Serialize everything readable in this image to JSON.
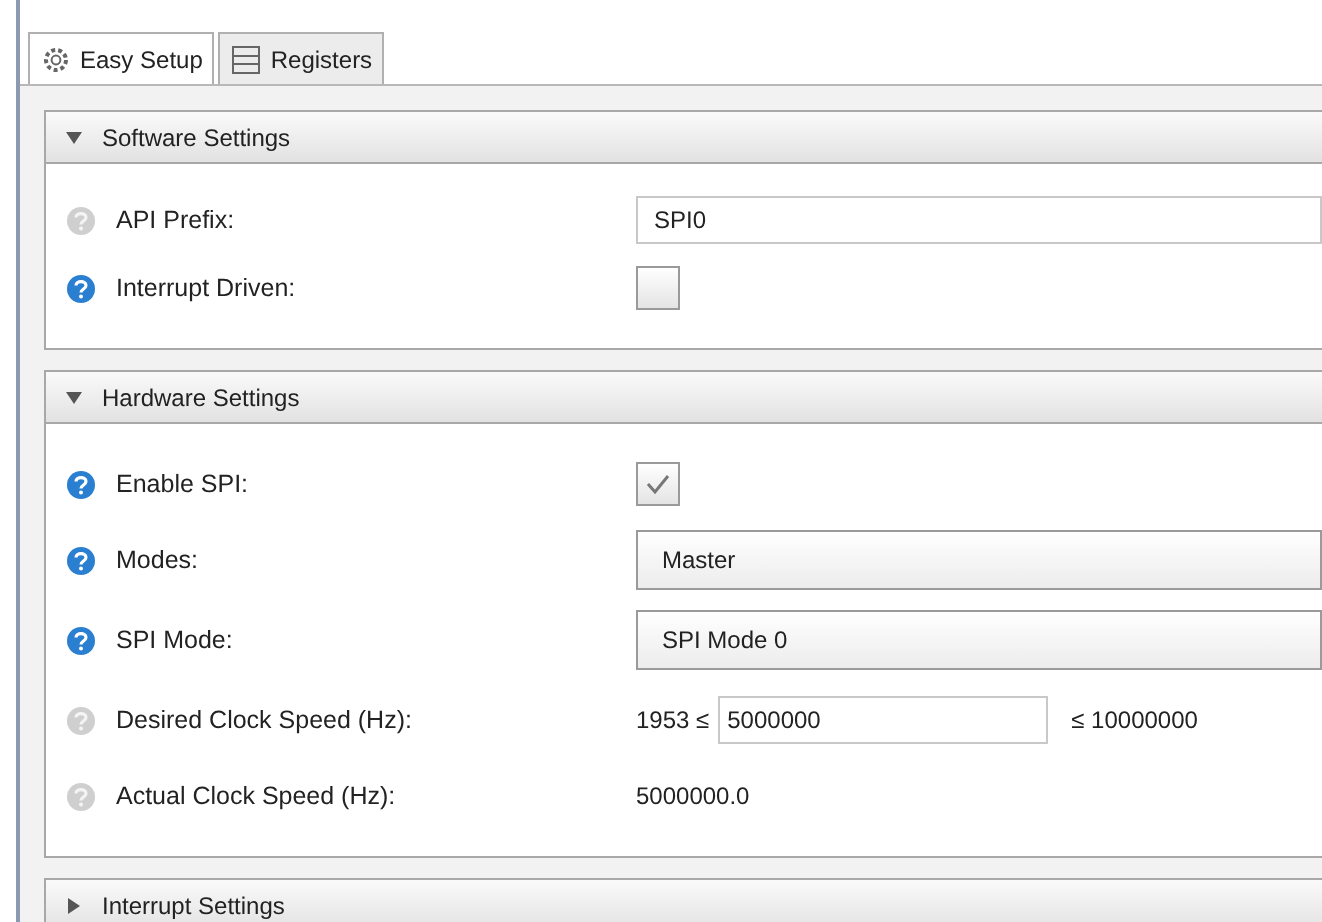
{
  "tabs": [
    {
      "label": "Easy Setup",
      "selected": true
    },
    {
      "label": "Registers",
      "selected": false
    }
  ],
  "sections": [
    {
      "title": "Software Settings",
      "expanded": true,
      "rows": [
        {
          "label": "API Prefix:",
          "help_active": false,
          "kind": "text",
          "value": "SPI0"
        },
        {
          "label": "Interrupt Driven:",
          "help_active": true,
          "kind": "checkbox",
          "checked": false
        }
      ]
    },
    {
      "title": "Hardware Settings",
      "expanded": true,
      "rows": [
        {
          "label": "Enable SPI:",
          "help_active": true,
          "kind": "checkbox",
          "checked": true
        },
        {
          "label": "Modes:",
          "help_active": true,
          "kind": "select",
          "value": "Master"
        },
        {
          "label": "SPI Mode:",
          "help_active": true,
          "kind": "select",
          "value": "SPI Mode 0"
        },
        {
          "label": "Desired Clock Speed (Hz):",
          "help_active": false,
          "kind": "range",
          "min": "1953 ≤",
          "value": "5000000",
          "max": "≤ 10000000"
        },
        {
          "label": "Actual Clock Speed (Hz):",
          "help_active": false,
          "kind": "readout",
          "value": "5000000.0"
        }
      ]
    },
    {
      "title": "Interrupt Settings",
      "expanded": false
    }
  ]
}
